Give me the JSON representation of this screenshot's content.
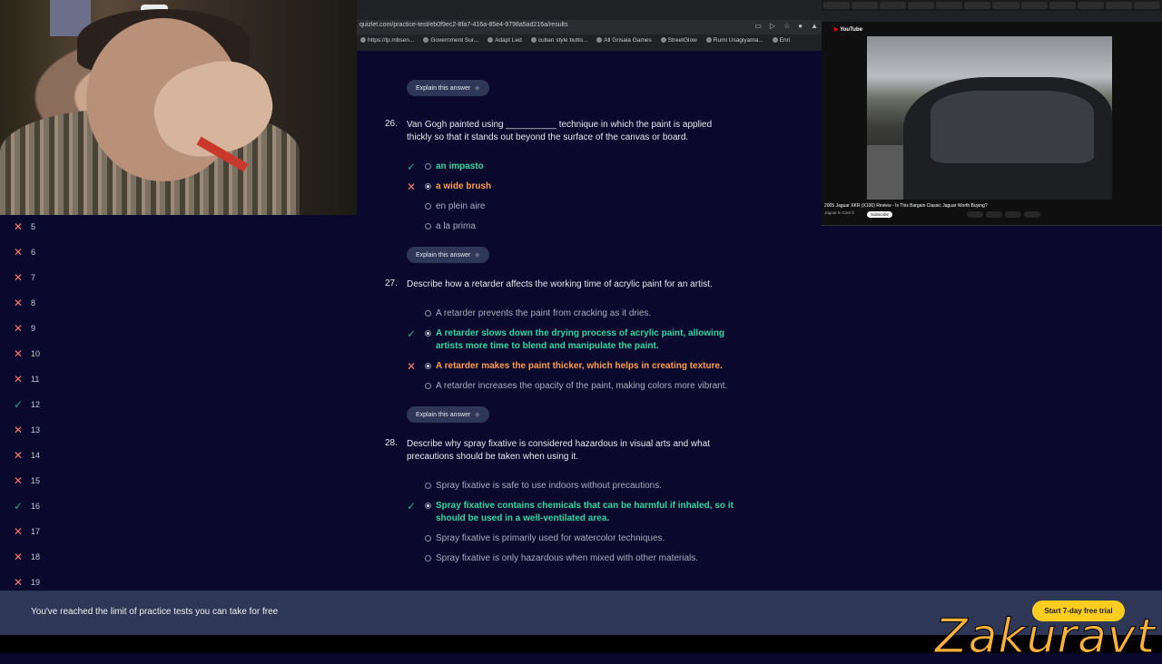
{
  "browser": {
    "url": "quizlet.com/practice-test/eb0f9ec2-8fa7-416a-85e4-9798a5ad216a/results",
    "bookmarks": [
      "https://lp.mbsen...",
      "Government Sur...",
      "Adapt Led",
      "cuban style butto...",
      "All Grisaia Games",
      "StreetGlow",
      "Rumi Usagiyama...",
      "Enri"
    ]
  },
  "youtube": {
    "logo": "YouTube",
    "video_title": "2005 Jaguar XKR (X100) Review - Is This Bargain Classic Jaguar Worth Buying?",
    "channel": "Jaguar in Cars ll",
    "subscribe": "Subscribe"
  },
  "sidebar": {
    "items": [
      {
        "num": "5",
        "status": "wrong"
      },
      {
        "num": "6",
        "status": "wrong"
      },
      {
        "num": "7",
        "status": "wrong"
      },
      {
        "num": "8",
        "status": "wrong"
      },
      {
        "num": "9",
        "status": "wrong"
      },
      {
        "num": "10",
        "status": "wrong"
      },
      {
        "num": "11",
        "status": "wrong"
      },
      {
        "num": "12",
        "status": "right"
      },
      {
        "num": "13",
        "status": "wrong"
      },
      {
        "num": "14",
        "status": "wrong"
      },
      {
        "num": "15",
        "status": "wrong"
      },
      {
        "num": "16",
        "status": "right"
      },
      {
        "num": "17",
        "status": "wrong"
      },
      {
        "num": "18",
        "status": "wrong"
      },
      {
        "num": "19",
        "status": "wrong"
      }
    ]
  },
  "explain_label": "Explain this answer",
  "questions": [
    {
      "num": "26.",
      "text": "Van Gogh painted using __________ technique in which the paint is applied thickly so that it stands out beyond the surface of the canvas or board.",
      "options": [
        {
          "text": "an impasto",
          "state": "correct"
        },
        {
          "text": "a wide brush",
          "state": "incorrect"
        },
        {
          "text": "en plein aire",
          "state": "neutral"
        },
        {
          "text": "a la prima",
          "state": "neutral"
        }
      ]
    },
    {
      "num": "27.",
      "text": "Describe how a retarder affects the working time of acrylic paint for an artist.",
      "options": [
        {
          "text": "A retarder prevents the paint from cracking as it dries.",
          "state": "neutral"
        },
        {
          "text": "A retarder slows down the drying process of acrylic paint, allowing",
          "text2": "artists more time to blend and manipulate the paint.",
          "state": "correct"
        },
        {
          "text": "A retarder makes the paint thicker, which helps in creating texture.",
          "state": "incorrect"
        },
        {
          "text": "A retarder increases the opacity of the paint, making colors more vibrant.",
          "state": "neutral"
        }
      ]
    },
    {
      "num": "28.",
      "text": "Describe why spray fixative is considered hazardous in visual arts and what precautions should be taken when using it.",
      "options": [
        {
          "text": "Spray fixative is safe to use indoors without precautions.",
          "state": "neutral"
        },
        {
          "text": "Spray fixative contains chemicals that can be harmful if inhaled, so it",
          "text2": "should be used in a well-ventilated area.",
          "state": "correct"
        },
        {
          "text": "Spray fixative is primarily used for watercolor techniques.",
          "state": "neutral"
        },
        {
          "text": "Spray fixative is only hazardous when mixed with other materials.",
          "state": "neutral"
        }
      ]
    }
  ],
  "banner": {
    "text": "You've reached the limit of practice tests you can take for free",
    "button": "Start 7-day free trial"
  },
  "watermark": "Zakuravt",
  "colors": {
    "background": "#0a092d",
    "correct": "#2dd8a0",
    "incorrect": "#ff9d4d",
    "cta": "#ffcd1f"
  }
}
